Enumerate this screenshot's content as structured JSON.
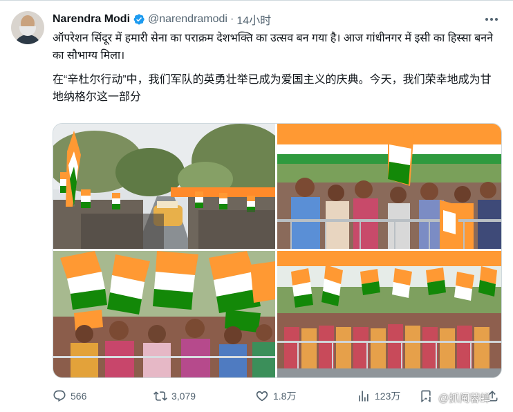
{
  "post": {
    "author_name": "Narendra Modi",
    "handle": "@narendramodi",
    "separator": "·",
    "time": "14小时",
    "text_hindi": "ऑपरेशन सिंदूर में हमारी सेना का पराक्रम देशभक्ति का उत्सव बन गया है। आज गांधीनगर में इसी का हिस्सा बनने का सौभाग्य मिला।",
    "text_chinese": "在“辛杜尔行动”中，我们军队的英勇壮举已成为爱国主义的庆典。今天，我们荣幸地成为甘地纳格尔这一部分"
  },
  "stats": {
    "replies": "566",
    "retweets": "3,079",
    "likes": "1.8万",
    "views": "123万"
  },
  "watermark": "@抓阄蓉蝉",
  "colors": {
    "text": "#0f1419",
    "secondary": "#536471",
    "verified": "#1d9bf0",
    "saffron": "#ff9933",
    "green": "#138808"
  },
  "icons": [
    "verified-badge-icon",
    "more-icon",
    "reply-icon",
    "retweet-icon",
    "like-icon",
    "views-icon",
    "bookmark-icon",
    "share-icon"
  ]
}
